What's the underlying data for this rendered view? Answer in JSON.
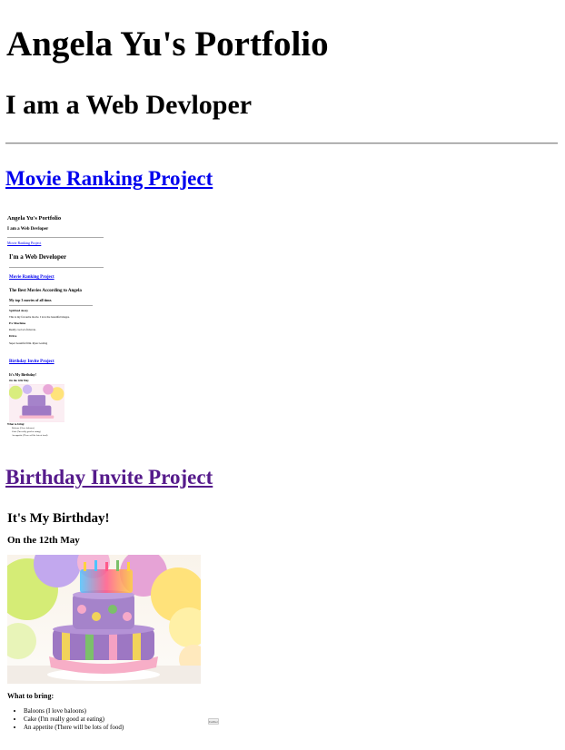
{
  "page": {
    "title": "Angela Yu's Portfolio",
    "subtitle": "I am a Web Devloper"
  },
  "projects": [
    {
      "label": "Movie Ranking Project"
    },
    {
      "label": "Birthday Invite Project"
    }
  ],
  "thumbnail": {
    "title": "Angela Yu's Portfolio",
    "subtitle": "I am a Web Devloper",
    "link": "Movie Ranking Project",
    "inner_heading": "I'm a Web Developer",
    "movie_link": "Movie Ranking Project",
    "movie_title": "The Best Movies According to Angela",
    "movie_subtitle": "My top 3 movies of all time.",
    "movies": [
      {
        "name": "Spirited Away",
        "note": "This is my favourite movie. I love the beautiful images."
      },
      {
        "name": "Ex Machina",
        "note": "Really cool sci-fi movie."
      },
      {
        "name": "Drive",
        "note": "Super beautiful film. Ryan Gosling"
      }
    ],
    "birthday_link": "Birthday Invite Project",
    "birthday_heading": "It's My Birthday!",
    "birthday_date": "On the 12th May",
    "bring_heading": "What to bring:",
    "bring_items": [
      "Baloons (I love baloons)",
      "Cake (I'm really good at eating)",
      "An appetite (There will be lots of food)"
    ]
  },
  "birthday": {
    "heading": "It's My Birthday!",
    "date": "On the 12th May",
    "bring_heading": "What to bring:",
    "bring_items": [
      "Baloons (I love baloons)",
      "Cake (I'm really good at eating)",
      "An appetite (There will be lots of food)"
    ],
    "button_label": "Further"
  }
}
